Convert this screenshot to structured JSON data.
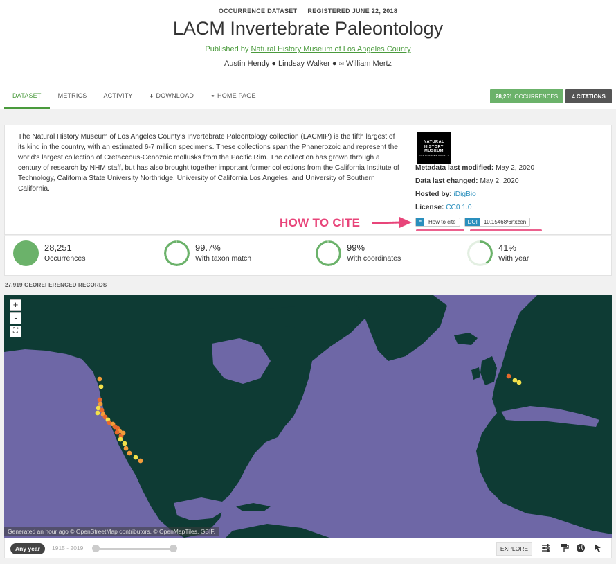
{
  "header": {
    "dataset_type": "OCCURRENCE DATASET",
    "registered": "REGISTERED JUNE 22, 2018",
    "title": "LACM Invertebrate Paleontology",
    "published_by_label": "Published by",
    "publisher": "Natural History Museum of Los Angeles County",
    "authors": [
      "Austin Hendy",
      "Lindsay Walker",
      "William Mertz"
    ]
  },
  "tabs": [
    {
      "label": "DATASET",
      "active": true
    },
    {
      "label": "METRICS"
    },
    {
      "label": "ACTIVITY"
    },
    {
      "label": "DOWNLOAD",
      "icon": "download-icon"
    },
    {
      "label": "HOME PAGE",
      "icon": "link-icon"
    }
  ],
  "badges": {
    "occurrences_count": "28,251",
    "occurrences_label": "OCCURRENCES",
    "citations": "4 CITATIONS"
  },
  "description": "The Natural History Museum of Los Angeles County's Invertebrate Paleontology collection (LACMIP) is the fifth largest of its kind in the country, with an estimated 6-7 million specimens. These collections span the Phanerozoic and represent the world's largest collection of Cretaceous-Cenozoic mollusks from the Pacific Rim. The collection has grown through a century of research by NHM staff, but has also brought together important former collections from the California Institute of Technology, California State University Northridge, University of California Los Angeles, and University of Southern California.",
  "logo": {
    "lines": [
      "NATURAL",
      "HISTORY",
      "MUSEUM"
    ],
    "subline": "LOS ANGELES COUNTY"
  },
  "meta": {
    "metadata_modified_label": "Metadata last modified:",
    "metadata_modified": "May 2, 2020",
    "data_changed_label": "Data last changed:",
    "data_changed": "May 2, 2020",
    "hosted_by_label": "Hosted by:",
    "hosted_by": "iDigBio",
    "license_label": "License:",
    "license": "CC0 1.0"
  },
  "cite": {
    "annotation": "HOW TO CITE",
    "how_to_cite": "How to cite",
    "doi_tag": "DOI",
    "doi": "10.15468/6nxzen"
  },
  "stats": [
    {
      "value": "28,251",
      "label": "Occurrences",
      "fraction": 1.0
    },
    {
      "value": "99.7%",
      "label": "With taxon match",
      "fraction": 0.997
    },
    {
      "value": "99%",
      "label": "With coordinates",
      "fraction": 0.99
    },
    {
      "value": "41%",
      "label": "With year",
      "fraction": 0.41
    }
  ],
  "georeferenced": "27,919 GEOREFERENCED RECORDS",
  "map": {
    "zoom_in": "+",
    "zoom_out": "-",
    "fullscreen": "⛶",
    "attribution": "Generated an hour ago © OpenStreetMap contributors, © OpenMapTiles, GBIF.",
    "water_color": "#6e67a6",
    "land_color": "#0e3b34"
  },
  "mapbar": {
    "any_year": "Any year",
    "year_range": "1915 - 2019",
    "explore": "EXPLORE"
  },
  "colors": {
    "accent_green": "#4a9a3c",
    "link_blue": "#2a8fbd",
    "annotation_pink": "#e8457a"
  }
}
